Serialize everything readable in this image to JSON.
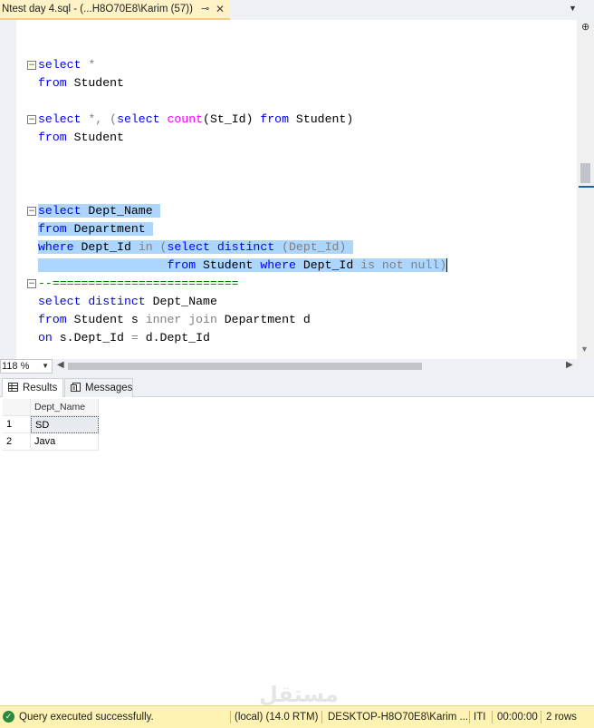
{
  "tab": {
    "title": "Ntest day 4.sql - (...H8O70E8\\Karim (57))",
    "pin_icon": "pin-icon",
    "close_icon": "close-icon"
  },
  "editor": {
    "lines": [
      {
        "fold": "minus",
        "tokens": [
          {
            "t": "select",
            "c": "kw"
          },
          {
            "t": " *",
            "c": "gr"
          }
        ]
      },
      {
        "tokens": [
          {
            "t": "from",
            "c": "kw"
          },
          {
            "t": " Student",
            "c": ""
          }
        ]
      },
      {
        "tokens": []
      },
      {
        "fold": "minus",
        "tokens": [
          {
            "t": "select",
            "c": "kw"
          },
          {
            "t": " *, (",
            "c": "gr"
          },
          {
            "t": "select",
            "c": "kw"
          },
          {
            "t": " ",
            "c": ""
          },
          {
            "t": "count",
            "c": "fn"
          },
          {
            "t": "(St_Id) ",
            "c": ""
          },
          {
            "t": "from",
            "c": "kw"
          },
          {
            "t": " Student)",
            "c": ""
          }
        ]
      },
      {
        "tokens": [
          {
            "t": "from",
            "c": "kw"
          },
          {
            "t": " Student",
            "c": ""
          }
        ]
      },
      {
        "tokens": []
      },
      {
        "tokens": []
      },
      {
        "tokens": []
      },
      {
        "fold": "minus",
        "selected": true,
        "tokens": [
          {
            "t": "select",
            "c": "kw"
          },
          {
            "t": " Dept_Name ",
            "c": ""
          }
        ]
      },
      {
        "selected": true,
        "tokens": [
          {
            "t": "from",
            "c": "kw"
          },
          {
            "t": " Department ",
            "c": ""
          }
        ]
      },
      {
        "selected": true,
        "tokens": [
          {
            "t": "where",
            "c": "kw"
          },
          {
            "t": " Dept_Id ",
            "c": ""
          },
          {
            "t": "in",
            "c": "gr"
          },
          {
            "t": " (",
            "c": "gr"
          },
          {
            "t": "select distinct",
            "c": "kw"
          },
          {
            "t": " (Dept_Id) ",
            "c": "gr"
          }
        ]
      },
      {
        "selected": true,
        "caret": true,
        "tokens": [
          {
            "t": "                  ",
            "c": ""
          },
          {
            "t": "from",
            "c": "kw"
          },
          {
            "t": " Student ",
            "c": ""
          },
          {
            "t": "where",
            "c": "kw"
          },
          {
            "t": " Dept_Id ",
            "c": ""
          },
          {
            "t": "is not null",
            "c": "gr"
          },
          {
            "t": ")",
            "c": "gr"
          }
        ]
      },
      {
        "fold": "minus",
        "tokens": [
          {
            "t": "--==========================",
            "c": "cm"
          }
        ]
      },
      {
        "tokens": [
          {
            "t": "select distinct",
            "c": "kw"
          },
          {
            "t": " Dept_Name",
            "c": ""
          }
        ]
      },
      {
        "tokens": [
          {
            "t": "from",
            "c": "kw"
          },
          {
            "t": " Student s ",
            "c": ""
          },
          {
            "t": "inner join",
            "c": "gr"
          },
          {
            "t": " Department d",
            "c": ""
          }
        ]
      },
      {
        "tokens": [
          {
            "t": "on",
            "c": "kw"
          },
          {
            "t": " s.Dept_Id ",
            "c": ""
          },
          {
            "t": "=",
            "c": "gr"
          },
          {
            "t": " d.Dept_Id",
            "c": ""
          }
        ]
      }
    ]
  },
  "zoom": {
    "value": "118 %"
  },
  "results": {
    "tabs": [
      {
        "label": "Results",
        "icon": "grid-icon",
        "active": true
      },
      {
        "label": "Messages",
        "icon": "messages-icon",
        "active": false
      }
    ],
    "columns": [
      "Dept_Name"
    ],
    "rows": [
      {
        "num": "1",
        "values": [
          "SD"
        ]
      },
      {
        "num": "2",
        "values": [
          "Java"
        ]
      }
    ]
  },
  "watermark": "مستقل",
  "status": {
    "message": "Query executed successfully.",
    "server": "(local) (14.0 RTM)",
    "user": "DESKTOP-H8O70E8\\Karim ...",
    "db": "ITI",
    "time": "00:00:00",
    "rows": "2 rows"
  }
}
